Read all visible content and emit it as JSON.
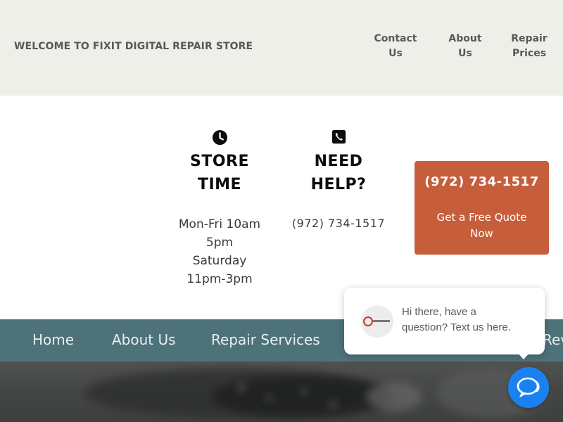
{
  "header": {
    "welcome": "WELCOME TO FIXIT DIGITAL REPAIR STORE",
    "nav": {
      "contact": "Contact\nUs",
      "about": "About\nUs",
      "repair": "Repair\nPrices"
    }
  },
  "info": {
    "store": {
      "icon": "clock-icon",
      "heading": "STORE\nTIME",
      "hours": "Mon-Fri 10am\n5pm\nSaturday\n11pm-3pm"
    },
    "help": {
      "icon": "phone-icon",
      "heading": "NEED\nHELP?",
      "phone": "(972) 734-1517"
    }
  },
  "quote": {
    "phone": "(972) 734-1517",
    "text": "Get a Free Quote Now",
    "color": "#c65e3c"
  },
  "main_nav": {
    "items": [
      "Home",
      "About Us",
      "Repair Services",
      "Rev"
    ],
    "color": "#4e727a"
  },
  "chat": {
    "message": "Hi there, have a\nquestion? Text us here.",
    "launcher_icon": "chat-icon",
    "launcher_color": "#1a82f0"
  }
}
